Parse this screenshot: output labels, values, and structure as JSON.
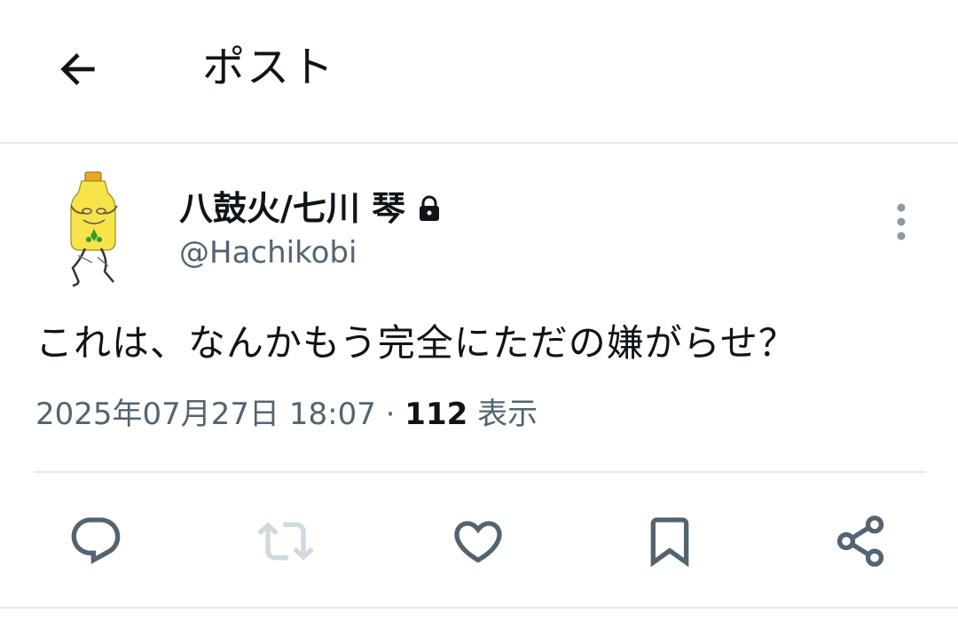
{
  "header": {
    "title": "ポスト"
  },
  "author": {
    "display_name": "八鼓火/七川 琴",
    "handle": "@Hachikobi",
    "protected": true
  },
  "post": {
    "text": "これは、なんかもう完全にただの嫌がらせ？",
    "timestamp": "2025年07月27日 18:07",
    "separator": "·",
    "views_count": "112",
    "views_label": "表示"
  },
  "actions": [
    "reply-icon",
    "repost-icon",
    "like-icon",
    "bookmark-icon",
    "share-icon"
  ],
  "colors": {
    "text_primary": "#0f1419",
    "text_secondary": "#536471",
    "divider": "#e7e9ea",
    "disabled_icon": "#cfd9de"
  }
}
